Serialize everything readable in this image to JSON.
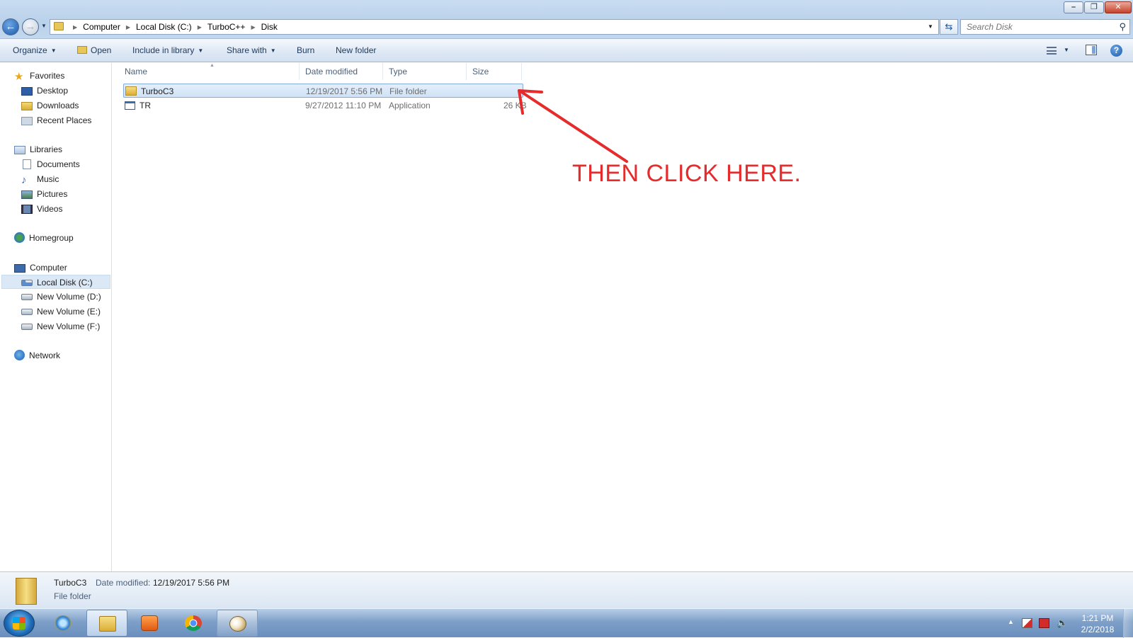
{
  "window": {
    "address": {
      "crumbs": [
        "Computer",
        "Local Disk (C:)",
        "TurboC++",
        "Disk"
      ]
    },
    "search": {
      "placeholder": "Search Disk"
    }
  },
  "commandbar": {
    "organize": "Organize",
    "open": "Open",
    "include_in_library": "Include in library",
    "share_with": "Share with",
    "burn": "Burn",
    "new_folder": "New folder"
  },
  "navpane": {
    "favorites": {
      "label": "Favorites",
      "items": [
        "Desktop",
        "Downloads",
        "Recent Places"
      ]
    },
    "libraries": {
      "label": "Libraries",
      "items": [
        "Documents",
        "Music",
        "Pictures",
        "Videos"
      ]
    },
    "homegroup": {
      "label": "Homegroup"
    },
    "computer": {
      "label": "Computer",
      "items": [
        "Local Disk (C:)",
        "New Volume (D:)",
        "New Volume (E:)",
        "New Volume (F:)"
      ],
      "selected": "Local Disk (C:)"
    },
    "network": {
      "label": "Network"
    }
  },
  "columns": [
    "Name",
    "Date modified",
    "Type",
    "Size"
  ],
  "files": [
    {
      "name": "TurboC3",
      "date_modified": "12/19/2017 5:56 PM",
      "type": "File folder",
      "size": "",
      "icon": "folder-icon",
      "selected": true
    },
    {
      "name": "TR",
      "date_modified": "9/27/2012 11:10 PM",
      "type": "Application",
      "size": "26 KB",
      "icon": "application-icon",
      "selected": false
    }
  ],
  "annotation": {
    "text": "THEN CLICK HERE.",
    "color": "#e52b2b"
  },
  "details": {
    "name": "TurboC3",
    "date_label": "Date modified:",
    "date": "12/19/2017 5:56 PM",
    "type": "File folder"
  },
  "taskbar": {
    "pinned": [
      "internet-explorer-icon",
      "windows-explorer-icon",
      "windows-media-player-icon",
      "google-chrome-icon",
      "paint-icon"
    ],
    "clock": {
      "time": "1:21 PM",
      "date": "2/2/2018"
    }
  }
}
